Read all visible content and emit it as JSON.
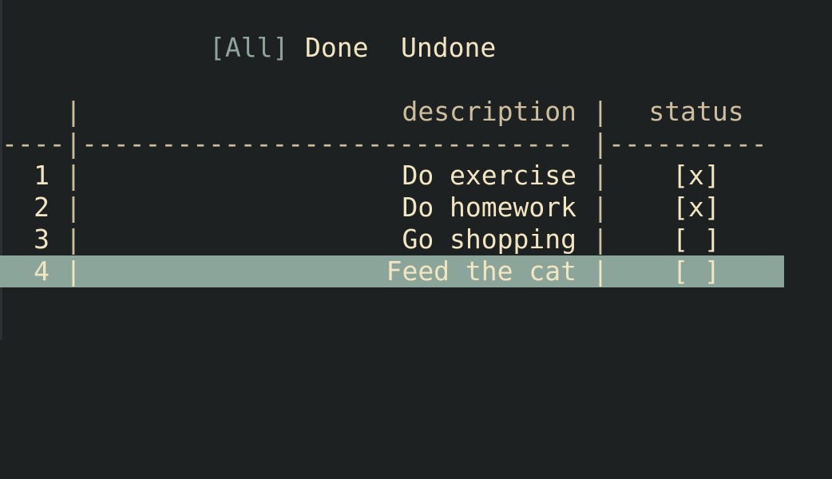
{
  "tabs": {
    "active_label": "[All]",
    "done_label": "Done",
    "undone_label": "Undone"
  },
  "table": {
    "columns": [
      "",
      "description",
      "status"
    ],
    "separator": "|",
    "divider": {
      "col1": "----",
      "col2": "-------------------------------",
      "col3": "----------"
    },
    "rows": [
      {
        "index": "1",
        "description": "Do exercise",
        "status": "[x]"
      },
      {
        "index": "2",
        "description": "Do homework",
        "status": "[x]"
      },
      {
        "index": "3",
        "description": "Go shopping",
        "status": "[ ]"
      },
      {
        "index": "4",
        "description": "Feed the cat",
        "status": "[ ]"
      }
    ],
    "selected_row": 4
  },
  "colors": {
    "background": "#1e2122",
    "text": "#f2e6c2",
    "muted": "#8fa39a",
    "selection": "#8ba59a"
  }
}
